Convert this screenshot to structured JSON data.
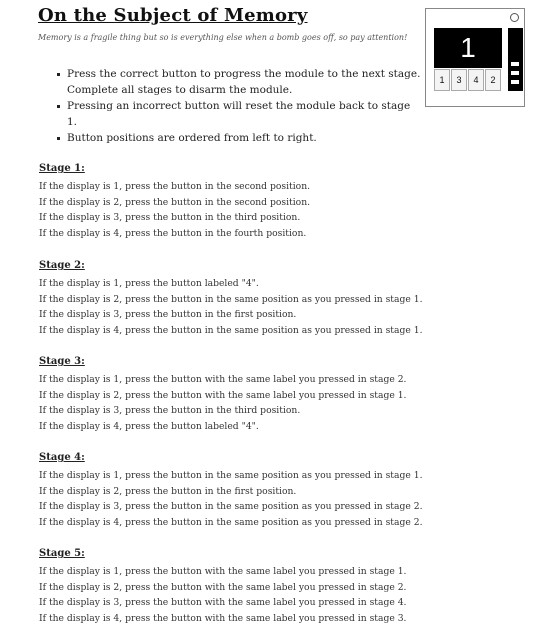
{
  "title": "On the Subject of Memory",
  "flavor": "Memory is a fragile thing but so is everything else when a bomb goes off, so pay attention!",
  "rules": [
    "Press the correct button to progress the module to the next stage. Complete all stages to disarm the module.",
    "Pressing an incorrect button will reset the module back to stage 1.",
    "Button positions are ordered from left to right."
  ],
  "module": {
    "display": "1",
    "buttons": [
      "1",
      "3",
      "4",
      "2"
    ],
    "stage_lamps_lit": 3
  },
  "stages": [
    {
      "heading": "Stage 1:",
      "lines": [
        "If the display is 1, press the button in the second position.",
        "If the display is 2, press the button in the second position.",
        "If the display is 3, press the button in the third position.",
        "If the display is 4, press the button in the fourth position."
      ]
    },
    {
      "heading": "Stage 2:",
      "lines": [
        "If the display is 1, press the button labeled \"4\".",
        "If the display is 2, press the button in the same position as you pressed in stage 1.",
        "If the display is 3, press the button in the first position.",
        "If the display is 4, press the button in the same position as you pressed in stage 1."
      ]
    },
    {
      "heading": "Stage 3:",
      "lines": [
        "If the display is 1, press the button with the same label you pressed in stage 2.",
        "If the display is 2, press the button with the same label you pressed in stage 1.",
        "If the display is 3, press the button in the third position.",
        "If the display is 4, press the button labeled \"4\"."
      ]
    },
    {
      "heading": "Stage 4:",
      "lines": [
        "If the display is 1, press the button in the same position as you pressed in stage 1.",
        "If the display is 2, press the button in the first position.",
        "If the display is 3, press the button in the same position as you pressed in stage 2.",
        "If the display is 4, press the button in the same position as you pressed in stage 2."
      ]
    },
    {
      "heading": "Stage 5:",
      "lines": [
        "If the display is 1, press the button with the same label you pressed in stage 1.",
        "If the display is 2, press the button with the same label you pressed in stage 2.",
        "If the display is 3, press the button with the same label you pressed in stage 4.",
        "If the display is 4, press the button with the same label you pressed in stage 3."
      ]
    }
  ]
}
